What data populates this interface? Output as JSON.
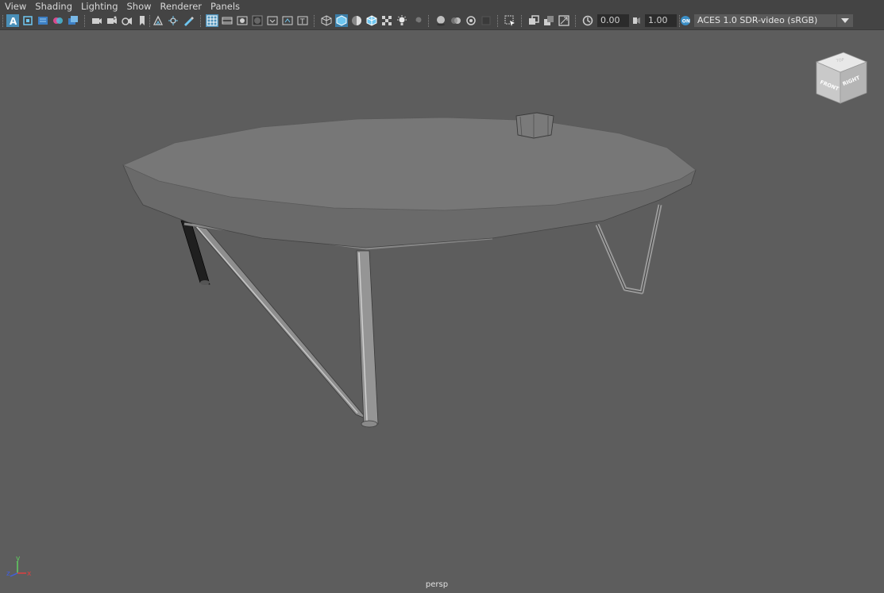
{
  "menu": [
    "View",
    "Shading",
    "Lighting",
    "Show",
    "Renderer",
    "Panels"
  ],
  "toolbar": {
    "exposure": "0.00",
    "gamma": "1.00",
    "color_space": "ACES 1.0 SDR-video (sRGB)",
    "active_color": "#4a8fb8"
  },
  "viewcube": {
    "front": "FRONT",
    "right": "RIGHT",
    "top": "TOP"
  },
  "axis": {
    "x": "x",
    "y": "y",
    "z": "z"
  },
  "viewport": {
    "camera": "persp",
    "background": "#5d5d5d"
  }
}
